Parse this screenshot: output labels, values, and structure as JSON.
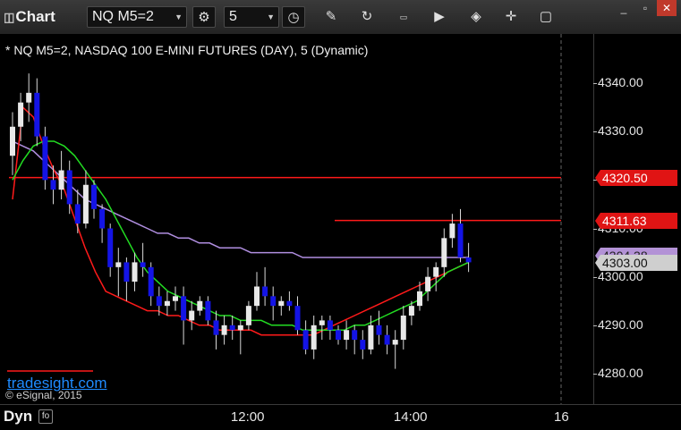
{
  "toolbar": {
    "title": "Chart",
    "symbol": "NQ M5=2",
    "interval": "5",
    "icons": [
      "settings-gear-icon",
      "clock-icon",
      "pencil-icon",
      "refresh-icon",
      "get-icon",
      "play-icon",
      "tag-icon",
      "comment-icon"
    ]
  },
  "chart_title": "* NQ M5=2, NASDAQ 100 E-MINI FUTURES (DAY), 5 (Dynamic)",
  "brand": "tradesight.com",
  "copyright": "© eSignal, 2015",
  "footer": {
    "mode": "Dyn",
    "icon_label": "fo"
  },
  "price_tags": {
    "red1": "4320.50",
    "red2": "4311.63",
    "purple": "4304.38",
    "last": "4303.00"
  },
  "colors": {
    "up": "#e8e8e8",
    "down": "#1414e6",
    "ma_red": "#ff1a1a",
    "ma_green": "#22dd22",
    "ma_purple": "#b08ee0",
    "level_red": "#ff1a1a"
  },
  "chart_data": {
    "type": "candlestick",
    "title": "* NQ M5=2, NASDAQ 100 E-MINI FUTURES (DAY), 5 (Dynamic)",
    "ylim": [
      4276,
      4346
    ],
    "yticks": [
      "4280.00",
      "4290.00",
      "4300.00",
      "4310.00",
      "4320.00",
      "4330.00",
      "4340.00"
    ],
    "ytick_values": [
      4280,
      4290,
      4300,
      4310,
      4320,
      4330,
      4340
    ],
    "xticks": [
      "12:00",
      "14:00",
      "16"
    ],
    "xtick_bar_index": [
      29,
      49,
      69
    ],
    "horizontal_levels": [
      {
        "name": "red-level-1",
        "value": 4320.5,
        "from_bar": 0
      },
      {
        "name": "red-level-2",
        "value": 4311.63,
        "from_bar": 40
      }
    ],
    "ohlc": [
      [
        4325,
        4334,
        4321,
        4331
      ],
      [
        4331,
        4338,
        4328,
        4336
      ],
      [
        4336,
        4342,
        4332,
        4338
      ],
      [
        4338,
        4341,
        4327,
        4329
      ],
      [
        4329,
        4331,
        4318,
        4320
      ],
      [
        4320,
        4323,
        4315,
        4318
      ],
      [
        4318,
        4326,
        4316,
        4322
      ],
      [
        4322,
        4324,
        4313,
        4315
      ],
      [
        4315,
        4318,
        4309,
        4311
      ],
      [
        4311,
        4322,
        4310,
        4319
      ],
      [
        4319,
        4320,
        4312,
        4314
      ],
      [
        4314,
        4315,
        4307,
        4310
      ],
      [
        4310,
        4311,
        4300,
        4302
      ],
      [
        4302,
        4306,
        4296,
        4303
      ],
      [
        4303,
        4304,
        4295,
        4299
      ],
      [
        4299,
        4305,
        4297,
        4303
      ],
      [
        4303,
        4307,
        4300,
        4302
      ],
      [
        4302,
        4303,
        4294,
        4296
      ],
      [
        4296,
        4298,
        4292,
        4294
      ],
      [
        4294,
        4297,
        4292,
        4295
      ],
      [
        4295,
        4298,
        4293,
        4296
      ],
      [
        4296,
        4298,
        4286,
        4291
      ],
      [
        4291,
        4295,
        4289,
        4293
      ],
      [
        4293,
        4296,
        4292,
        4295
      ],
      [
        4295,
        4296,
        4290,
        4291
      ],
      [
        4291,
        4293,
        4285,
        4288
      ],
      [
        4288,
        4292,
        4286,
        4290
      ],
      [
        4290,
        4292,
        4287,
        4289
      ],
      [
        4289,
        4291,
        4284,
        4290
      ],
      [
        4290,
        4295,
        4289,
        4294
      ],
      [
        4294,
        4301,
        4293,
        4298
      ],
      [
        4298,
        4302,
        4294,
        4296
      ],
      [
        4296,
        4298,
        4291,
        4294
      ],
      [
        4294,
        4296,
        4292,
        4295
      ],
      [
        4295,
        4297,
        4293,
        4294
      ],
      [
        4294,
        4296,
        4288,
        4289
      ],
      [
        4289,
        4291,
        4284,
        4285
      ],
      [
        4285,
        4292,
        4283,
        4290
      ],
      [
        4290,
        4292,
        4287,
        4291
      ],
      [
        4291,
        4292,
        4287,
        4289
      ],
      [
        4289,
        4290,
        4286,
        4287
      ],
      [
        4287,
        4291,
        4285,
        4289
      ],
      [
        4289,
        4290,
        4284,
        4287
      ],
      [
        4287,
        4289,
        4283,
        4285
      ],
      [
        4285,
        4292,
        4284,
        4290
      ],
      [
        4290,
        4293,
        4286,
        4288
      ],
      [
        4288,
        4290,
        4284,
        4286
      ],
      [
        4286,
        4289,
        4281,
        4287
      ],
      [
        4287,
        4294,
        4285,
        4292
      ],
      [
        4292,
        4295,
        4290,
        4294
      ],
      [
        4294,
        4299,
        4293,
        4297
      ],
      [
        4297,
        4302,
        4295,
        4300
      ],
      [
        4300,
        4303,
        4297,
        4302
      ],
      [
        4302,
        4310,
        4300,
        4308
      ],
      [
        4308,
        4313,
        4306,
        4311
      ],
      [
        4311,
        4314,
        4303,
        4304
      ],
      [
        4304,
        4307,
        4301,
        4303
      ]
    ],
    "ma_red": [
      4316,
      4335,
      4333,
      4327,
      4322,
      4318,
      4312,
      4306,
      4301,
      4297,
      4296,
      4295,
      4294,
      4293,
      4293,
      4292,
      4292,
      4291,
      4290,
      4290,
      4289,
      4289,
      4289,
      4289,
      4288,
      4288,
      4288,
      4288,
      4288,
      4288,
      4289,
      4290,
      4291,
      4292,
      4293,
      4294,
      4295,
      4296,
      4297,
      4298,
      4299,
      4300,
      4301,
      4302,
      4303
    ],
    "ma_green": [
      4320,
      4324,
      4327,
      4328,
      4328,
      4327,
      4325,
      4322,
      4319,
      4316,
      4312,
      4308,
      4304,
      4301,
      4299,
      4297,
      4296,
      4295,
      4294,
      4293,
      4292,
      4292,
      4291,
      4291,
      4291,
      4290,
      4290,
      4290,
      4289,
      4289,
      4289,
      4289,
      4289,
      4290,
      4290,
      4291,
      4292,
      4293,
      4294,
      4295,
      4297,
      4299,
      4301,
      4302,
      4303
    ],
    "ma_purple": [
      4328,
      4327,
      4326,
      4324,
      4322,
      4320,
      4318,
      4316,
      4315,
      4314,
      4313,
      4312,
      4311,
      4310,
      4309,
      4309,
      4308,
      4308,
      4307,
      4307,
      4306,
      4306,
      4306,
      4305,
      4305,
      4305,
      4305,
      4305,
      4304,
      4304,
      4304,
      4304,
      4304,
      4304,
      4304,
      4304,
      4304,
      4304,
      4304,
      4304,
      4304,
      4304,
      4304,
      4304,
      4304
    ]
  }
}
